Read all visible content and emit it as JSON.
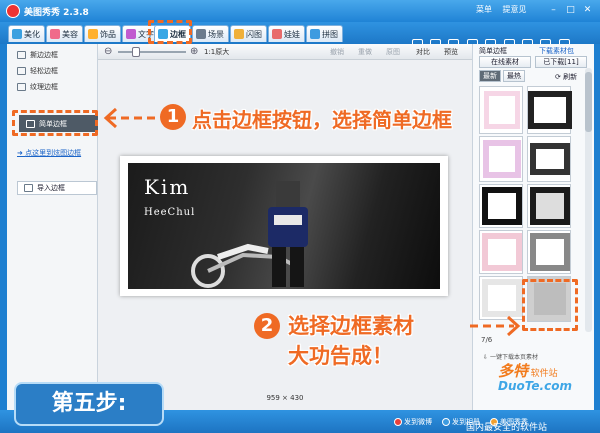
{
  "app": {
    "title": "美图秀秀 2.3.8"
  },
  "top_links": [
    "菜单",
    "提意见"
  ],
  "window_buttons": [
    "minimize",
    "maximize",
    "close"
  ],
  "tabs": [
    {
      "label": "美化",
      "color": "#3aa0e0"
    },
    {
      "label": "美容",
      "color": "#f06a8a"
    },
    {
      "label": "饰品",
      "color": "#ffb02e"
    },
    {
      "label": "文字",
      "color": "#c05ad0"
    },
    {
      "label": "边框",
      "color": "#39a7e5"
    },
    {
      "label": "场景",
      "color": "#6b7b8d"
    },
    {
      "label": "闪图",
      "color": "#f0b03a"
    },
    {
      "label": "娃娃",
      "color": "#e86b6b"
    },
    {
      "label": "拼图",
      "color": "#3e9be0"
    }
  ],
  "toolbar": [
    "打开",
    "保存",
    "抠图",
    "旋转",
    "缩放",
    "尺寸",
    "涂鸦",
    "拍照",
    "帮助"
  ],
  "left_panel": {
    "items": [
      "撕边边框",
      "轻松边框",
      "纹理边框",
      "简单边框"
    ],
    "selected": "简单边框",
    "link": "点这里到炫图边框",
    "import": "导入边框"
  },
  "zoombar": {
    "zoom": "1:1原大",
    "undo": "撤销",
    "redo": "重做",
    "reset": "原图",
    "compare": "对比",
    "preview": "预览"
  },
  "canvas": {
    "photo_title": "Kim",
    "photo_subtitle": "HeeChul",
    "dimensions": "959 × 430"
  },
  "right_panel": {
    "tab1": "简单边框",
    "tab2": "下载素材包",
    "online": "在线素材",
    "downloaded": "已下载[11]",
    "latest": "最新",
    "hot": "最热",
    "refresh": "刷新",
    "page": "7/6",
    "download_note": "一键下载本页素材"
  },
  "annotations": {
    "step1_num": "1",
    "step1_text": "点击边框按钮，选择简单边框",
    "step2_num": "2",
    "step2_text_line1": "选择边框素材",
    "step2_text_line2": "大功告成！",
    "step_label": "第五步:"
  },
  "status_bar": [
    "发到微博",
    "发到相册",
    "美图秀秀"
  ],
  "watermark": {
    "main": "多特",
    "sub": "软件站",
    "url": "DuoTe.com"
  },
  "watermark_line": "国内最安全的软件站"
}
